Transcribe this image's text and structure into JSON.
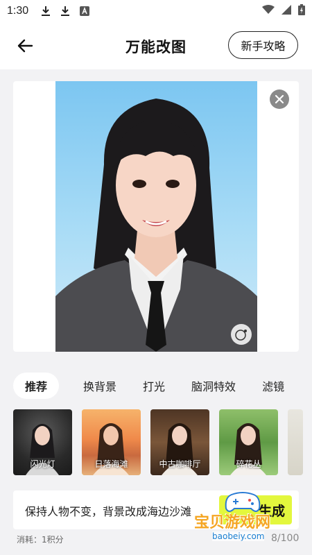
{
  "status_bar": {
    "time": "1:30",
    "left_icons": [
      "download-icon",
      "download-icon",
      "a-icon"
    ],
    "right_icons": [
      "wifi-icon",
      "signal-icon",
      "battery-icon"
    ]
  },
  "header": {
    "title": "万能改图",
    "guide_label": "新手攻略"
  },
  "tabs": [
    {
      "label": "推荐",
      "active": true
    },
    {
      "label": "换背景",
      "active": false
    },
    {
      "label": "打光",
      "active": false
    },
    {
      "label": "脑洞特效",
      "active": false
    },
    {
      "label": "滤镜",
      "active": false
    }
  ],
  "styles": [
    {
      "label": "闪光灯",
      "selected": false
    },
    {
      "label": "日落海滩",
      "selected": true
    },
    {
      "label": "中古咖啡厅",
      "selected": false
    },
    {
      "label": "碎花丛",
      "selected": false
    }
  ],
  "prompt": {
    "text": "保持人物不变，背景改成海边沙滩",
    "generate_label": "生成",
    "cost": "消耗：1积分",
    "counter": "8/100"
  },
  "watermark": {
    "title": "宝贝游戏网",
    "url": "baobeiy.com"
  },
  "colors": {
    "accent": "#e3f73d",
    "sky": "#7cc6f1"
  }
}
